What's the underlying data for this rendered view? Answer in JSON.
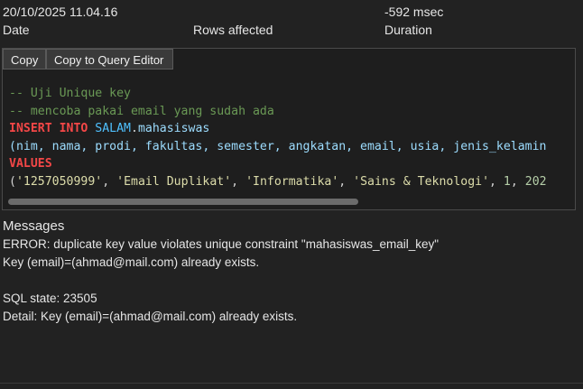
{
  "summary": {
    "timestamp": "20/10/2025 11.04.16",
    "rows_value": "",
    "duration_value": "-592 msec",
    "headers": {
      "date": "Date",
      "rows": "Rows affected",
      "duration": "Duration"
    }
  },
  "toolbar": {
    "copy_label": "Copy",
    "copy_query_label": "Copy to Query Editor"
  },
  "query": {
    "comment1": "-- Uji Unique key",
    "comment2": "-- mencoba pakai email yang sudah ada",
    "insert_kw": "INSERT INTO",
    "schema": "SALAM",
    "table": "mahasiswas",
    "columns": "(nim, nama, prodi, fakultas, semester, angkatan, email, usia, jenis_kelamin",
    "values_kw": "VALUES",
    "v_open": "(",
    "v1": "'1257050999'",
    "v2": "'Email Duplikat'",
    "v3": "'Informatika'",
    "v4": "'Sains & Teknologi'",
    "v5": "1",
    "v6": "202"
  },
  "messages": {
    "title": "Messages",
    "lines": [
      "ERROR:  duplicate key value violates unique constraint \"mahasiswas_email_key\"",
      "Key (email)=(ahmad@mail.com) already exists.",
      "",
      "SQL state: 23505",
      "Detail: Key (email)=(ahmad@mail.com) already exists."
    ]
  },
  "colors": {
    "background": "#222222",
    "comment": "#6a9955",
    "keyword": "#f44747",
    "string": "#dcdcaa",
    "number": "#b5cea8"
  }
}
